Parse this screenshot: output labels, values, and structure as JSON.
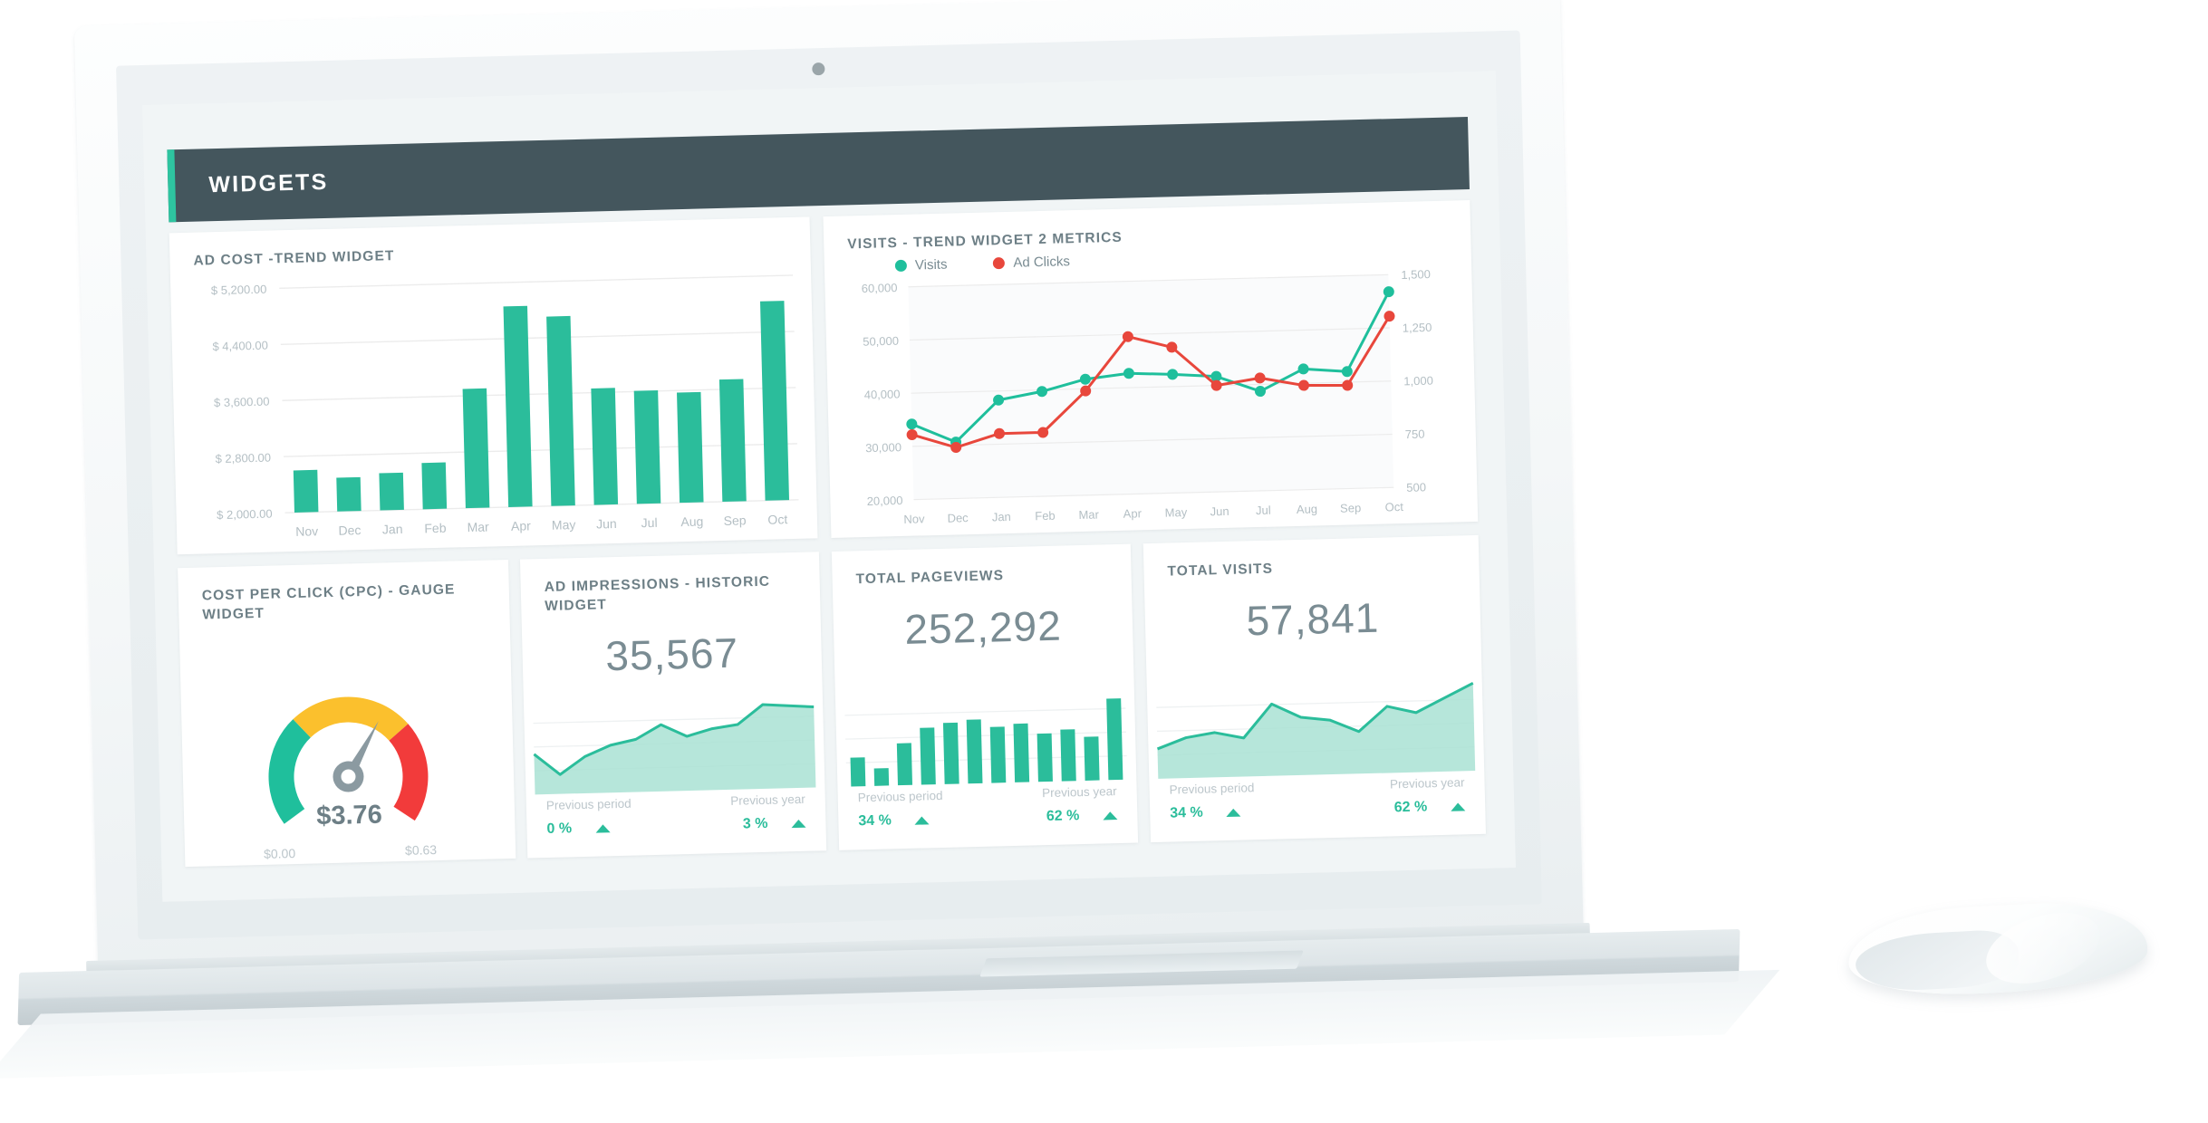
{
  "header": {
    "title": "WIDGETS",
    "accent_color": "#2ec4a0",
    "bar_color": "#44565d"
  },
  "theme": {
    "green": "#2bbd9b",
    "red": "#e8473c",
    "yellow": "#fbc02d",
    "text_gray": "#7a8c93",
    "muted": "#bcc6cb"
  },
  "cards": {
    "ad_cost": {
      "title": "AD COST -TREND WIDGET"
    },
    "visits": {
      "title": "VISITS - TREND WIDGET 2 METRICS"
    },
    "gauge": {
      "title": "COST PER CLICK (CPC) - GAUGE WIDGET",
      "value": "$3.76",
      "min": "$0.00",
      "max": "$0.63"
    },
    "impressions": {
      "title": "AD IMPRESSIONS - HISTORIC WIDGET",
      "value": "35,567",
      "prev_period_label": "Previous period",
      "prev_period_pct": "0 %",
      "prev_year_label": "Previous year",
      "prev_year_pct": "3 %"
    },
    "pageviews": {
      "title": "TOTAL PAGEVIEWS",
      "value": "252,292",
      "prev_period_label": "Previous period",
      "prev_period_pct": "34 %",
      "prev_year_label": "Previous year",
      "prev_year_pct": "62 %"
    },
    "visits_total": {
      "title": "TOTAL VISITS",
      "value": "57,841",
      "prev_period_label": "Previous period",
      "prev_period_pct": "34 %",
      "prev_year_label": "Previous year",
      "prev_year_pct": "62 %"
    }
  },
  "chart_data": [
    {
      "id": "ad_cost",
      "type": "bar",
      "title": "AD COST -TREND WIDGET",
      "xlabel": "",
      "ylabel": "",
      "ylim": [
        2000,
        5200
      ],
      "grid": true,
      "ytick_labels": [
        "$ 5,200.00",
        "$ 4,400.00",
        "$ 3,600.00",
        "$ 2,800.00",
        "$ 2,000.00"
      ],
      "yticks": [
        5200,
        4400,
        3600,
        2800,
        2000
      ],
      "categories": [
        "Nov",
        "Dec",
        "Jan",
        "Feb",
        "Mar",
        "Apr",
        "May",
        "Jun",
        "Jul",
        "Aug",
        "Sep",
        "Oct"
      ],
      "values": [
        2600,
        2480,
        2530,
        2660,
        3700,
        4860,
        4700,
        3660,
        3610,
        3570,
        3740,
        4840
      ],
      "color": "#2bbd9b"
    },
    {
      "id": "visits_ad_clicks",
      "type": "line",
      "title": "VISITS - TREND WIDGET 2 METRICS",
      "grid": true,
      "legend_position": "top-left",
      "categories": [
        "Nov",
        "Dec",
        "Jan",
        "Feb",
        "Mar",
        "Apr",
        "May",
        "Jun",
        "Jul",
        "Aug",
        "Sep",
        "Oct"
      ],
      "left_axis": {
        "label": "Visits",
        "ylim": [
          20000,
          60000
        ],
        "ytick_labels": [
          "60,000",
          "50,000",
          "40,000",
          "30,000",
          "20,000"
        ],
        "yticks": [
          60000,
          50000,
          40000,
          30000,
          20000
        ]
      },
      "right_axis": {
        "label": "Ad Clicks",
        "ylim": [
          500,
          1500
        ],
        "ytick_labels": [
          "1,500",
          "1,250",
          "1,000",
          "750",
          "500"
        ],
        "yticks": [
          1500,
          1250,
          1000,
          750,
          500
        ]
      },
      "series": [
        {
          "name": "Visits",
          "axis": "left",
          "color": "#1fbf9c",
          "values": [
            34200,
            30600,
            38300,
            39700,
            41800,
            42700,
            42300,
            41700,
            38700,
            42700,
            42000,
            56800
          ]
        },
        {
          "name": "Ad Clicks",
          "axis": "right",
          "color": "#e8473c",
          "values": [
            805,
            740,
            800,
            800,
            990,
            1240,
            1185,
            1000,
            1030,
            990,
            985,
            1305
          ]
        }
      ]
    },
    {
      "id": "cpc_gauge",
      "type": "gauge",
      "title": "COST PER CLICK (CPC) - GAUGE WIDGET",
      "value": 3.76,
      "value_label": "$3.76",
      "min_label": "$0.00",
      "max_label": "$0.63",
      "needle_fraction": 0.62,
      "bands": [
        {
          "color": "#1fbf9c",
          "from": 0.0,
          "to": 0.33
        },
        {
          "color": "#fbc02d",
          "from": 0.33,
          "to": 0.7
        },
        {
          "color": "#f23b3b",
          "from": 0.7,
          "to": 1.0
        }
      ]
    },
    {
      "id": "ad_impressions_spark",
      "type": "area",
      "title": "AD IMPRESSIONS - HISTORIC WIDGET",
      "values": [
        42,
        18,
        38,
        50,
        56,
        72,
        58,
        66,
        70,
        92,
        90,
        88
      ],
      "ylim": [
        0,
        100
      ],
      "color": "#2bbd9b",
      "fill": "#a9e2d3"
    },
    {
      "id": "total_pageviews_bars",
      "type": "bar",
      "title": "TOTAL PAGEVIEWS",
      "categories": [
        "1",
        "2",
        "3",
        "4",
        "5",
        "6",
        "7",
        "8",
        "9",
        "10",
        "11",
        "12"
      ],
      "values": [
        33,
        20,
        48,
        65,
        70,
        73,
        64,
        67,
        55,
        59,
        50,
        93
      ],
      "ylim": [
        0,
        100
      ],
      "color": "#2bbd9b"
    },
    {
      "id": "total_visits_spark",
      "type": "area",
      "title": "TOTAL VISITS",
      "values": [
        30,
        42,
        47,
        40,
        78,
        62,
        58,
        44,
        72,
        64,
        80,
        96
      ],
      "ylim": [
        0,
        100
      ],
      "color": "#2bbd9b",
      "fill": "#a9e2d3"
    }
  ]
}
